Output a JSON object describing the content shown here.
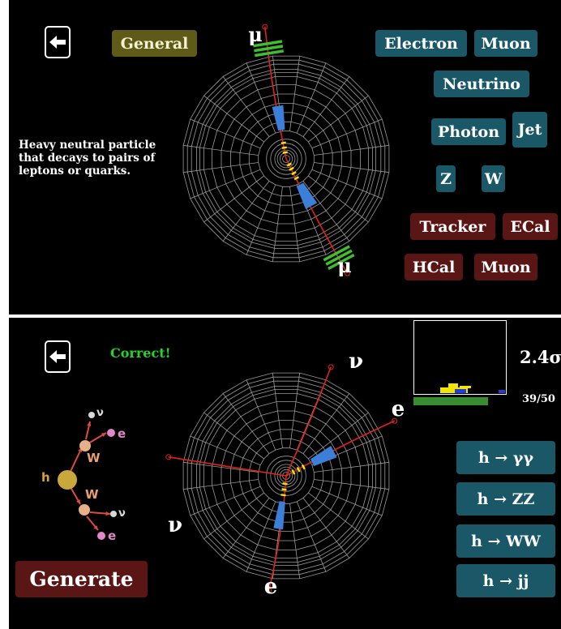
{
  "top": {
    "back_icon": "arrow-left-icon",
    "general_label": "General",
    "description": "Heavy neutral particle that decays to pairs of leptons or quarks.",
    "particle_buttons": [
      "Electron",
      "Muon",
      "Neutrino",
      "Photon",
      "Jet",
      "Z",
      "W"
    ],
    "detector_buttons": [
      "Tracker",
      "ECal",
      "HCal",
      "Muon"
    ],
    "track_labels": [
      "μ",
      "μ"
    ]
  },
  "bottom": {
    "back_icon": "arrow-left-icon",
    "feedback": "Correct!",
    "significance": "2.4σ",
    "counter": "39/50",
    "generate_label": "Generate",
    "decay_buttons": [
      "h → γγ",
      "h → ZZ",
      "h → WW",
      "h → jj"
    ],
    "track_labels": [
      "ν",
      "e",
      "ν",
      "e"
    ],
    "diagram_labels": {
      "h": "h",
      "w1": "W",
      "w2": "W",
      "nu1": "ν",
      "e1": "e",
      "nu2": "ν",
      "e2": "e"
    }
  },
  "colors": {
    "panel_bg": "#000000",
    "teal_button": "#1b5867",
    "maroon_button": "#5a1614",
    "olive_button": "#5e5a17",
    "correct_text": "#22d627",
    "track": "#e0231c",
    "ecal_deposit": "#3b7fd8",
    "tracker_hit": "#f2e600",
    "muon_chamber": "#3fbf2f"
  }
}
